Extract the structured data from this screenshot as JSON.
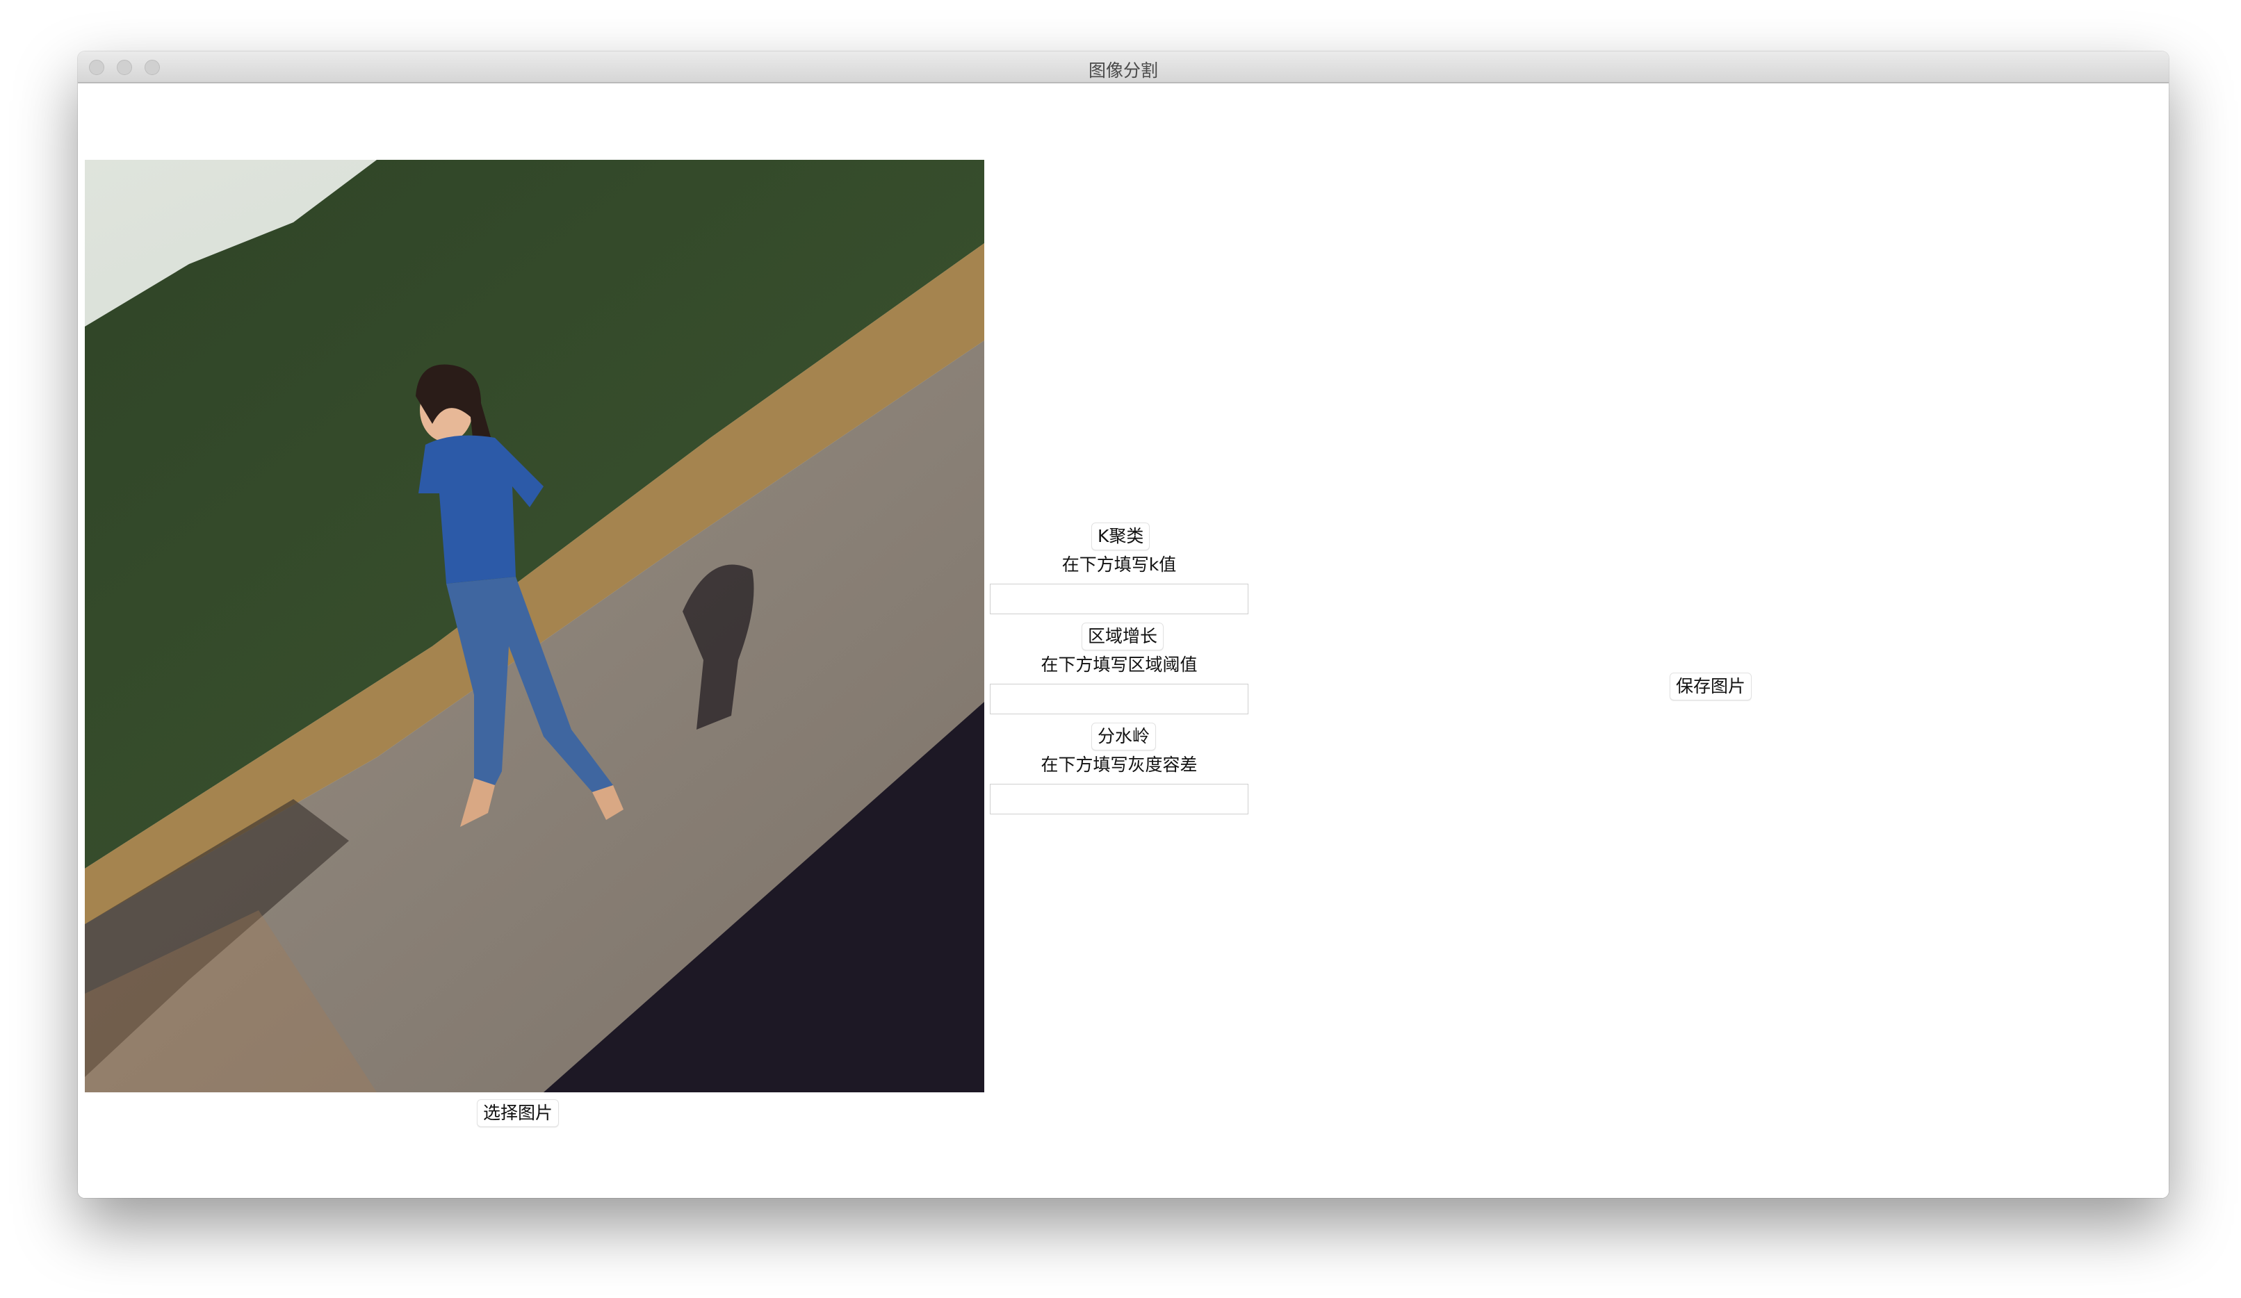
{
  "window": {
    "title": "图像分割"
  },
  "left_panel": {
    "photo": {
      "description_icon": "photo-image"
    },
    "select_button_label": "选择图片"
  },
  "middle_panel": {
    "kmeans": {
      "button_label": "K聚类",
      "hint": "在下方填写k值",
      "value": ""
    },
    "region_growing": {
      "button_label": "区域增长",
      "hint": "在下方填写区域阈值",
      "value": ""
    },
    "watershed": {
      "button_label": "分水岭",
      "hint": "在下方填写灰度容差",
      "value": ""
    }
  },
  "right_panel": {
    "save_button_label": "保存图片"
  }
}
